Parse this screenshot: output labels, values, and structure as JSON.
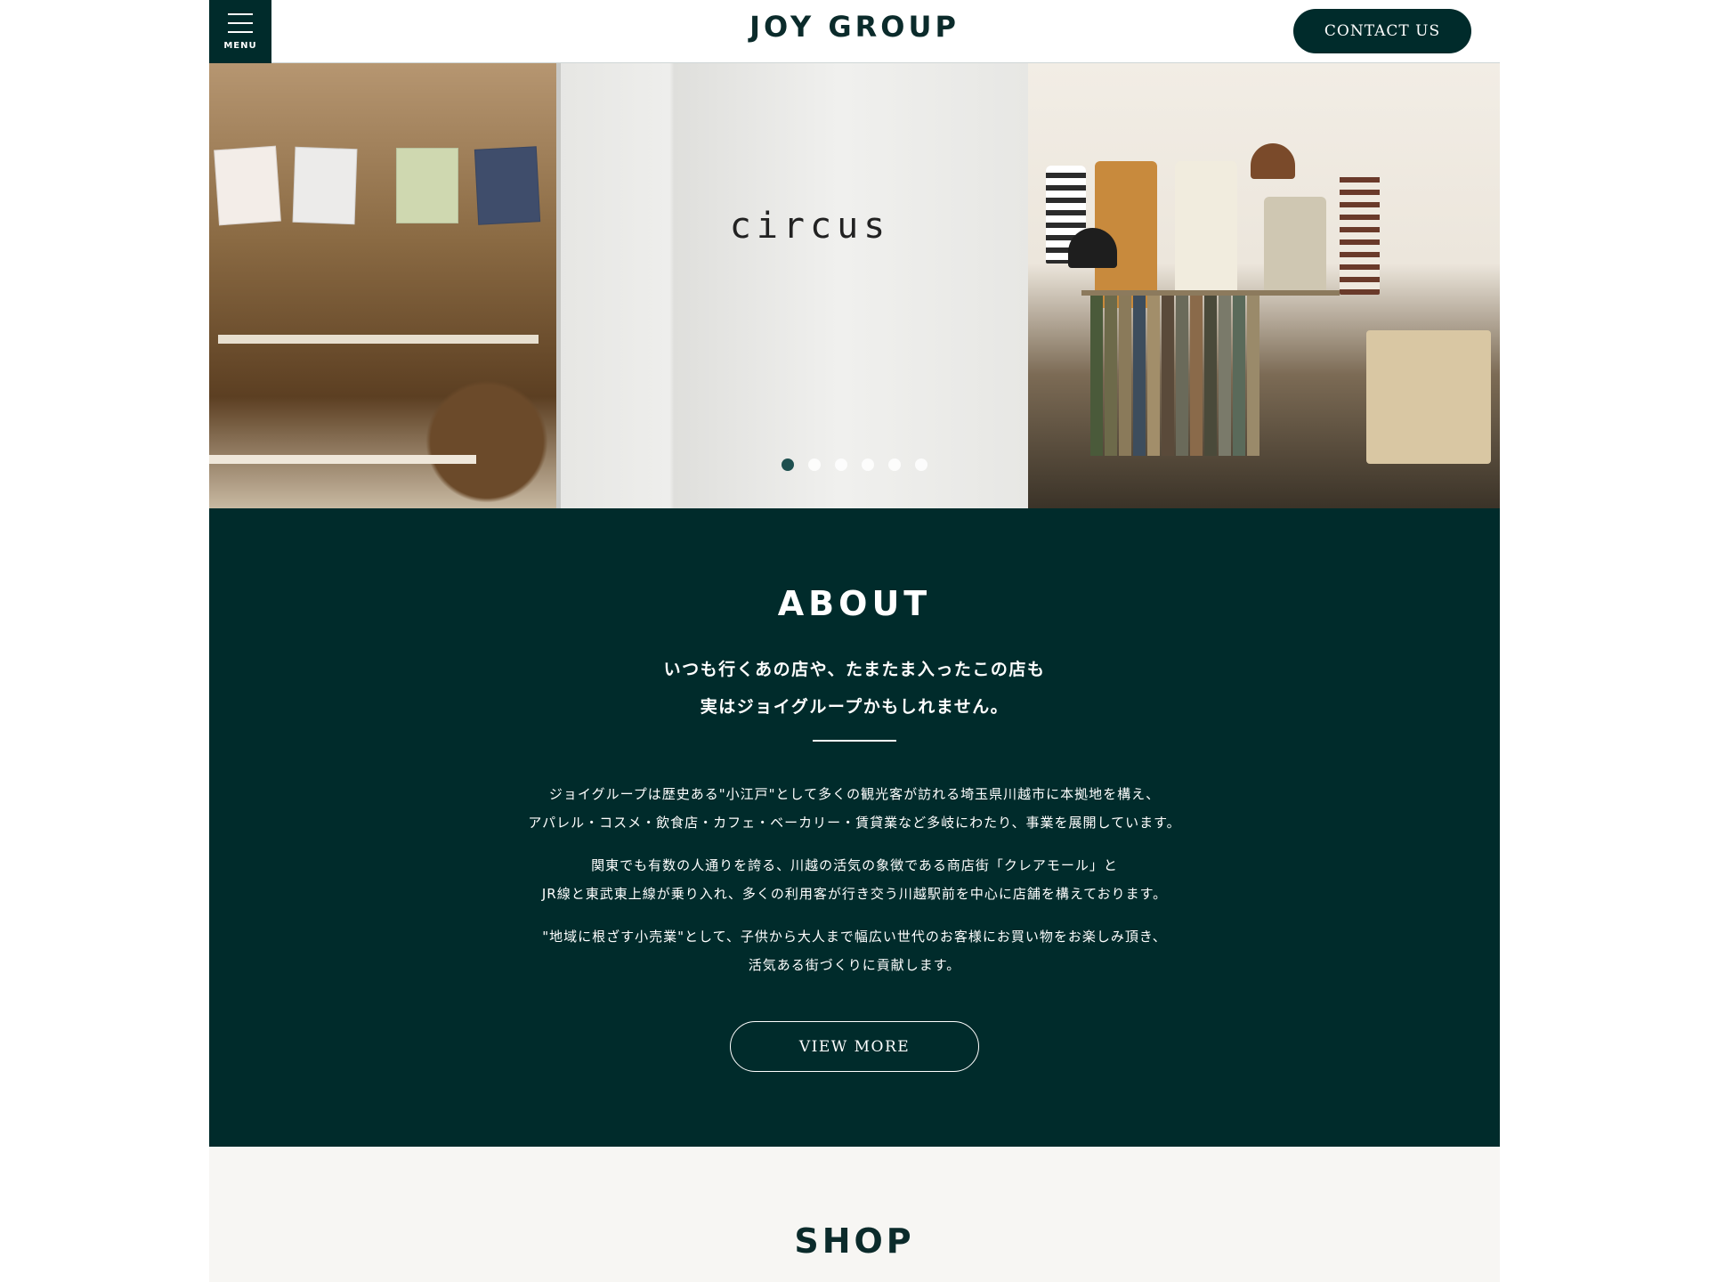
{
  "header": {
    "menu_label": "MENU",
    "logo_text": "JOY GROUP",
    "contact_label": "CONTACT US"
  },
  "hero": {
    "sign_text": "circus",
    "slide_count": 6,
    "active_slide": 1
  },
  "about": {
    "title": "ABOUT",
    "lead_lines": [
      "いつも行くあの店や、たまたま入ったこの店も",
      "実はジョイグループかもしれません。"
    ],
    "paragraphs": [
      [
        "ジョイグループは歴史ある\"小江戸\"として多くの観光客が訪れる埼玉県川越市に本拠地を構え、",
        "アパレル・コスメ・飲食店・カフェ・ベーカリー・賃貸業など多岐にわたり、事業を展開しています。"
      ],
      [
        "関東でも有数の人通りを誇る、川越の活気の象徴である商店街「クレアモール」と",
        "JR線と東武東上線が乗り入れ、多くの利用客が行き交う川越駅前を中心に店舗を構えております。"
      ],
      [
        "\"地域に根ざす小売業\"として、子供から大人まで幅広い世代のお客様にお買い物をお楽しみ頂き、",
        "活気ある街づくりに貢献します。"
      ]
    ],
    "view_more_label": "VIEW MORE"
  },
  "shop": {
    "title": "SHOP"
  },
  "colors": {
    "brand_dark": "#002b2b",
    "text_dark": "#0b2b2b",
    "shop_bg": "#f7f6f3",
    "active_dot": "#1f5050"
  }
}
